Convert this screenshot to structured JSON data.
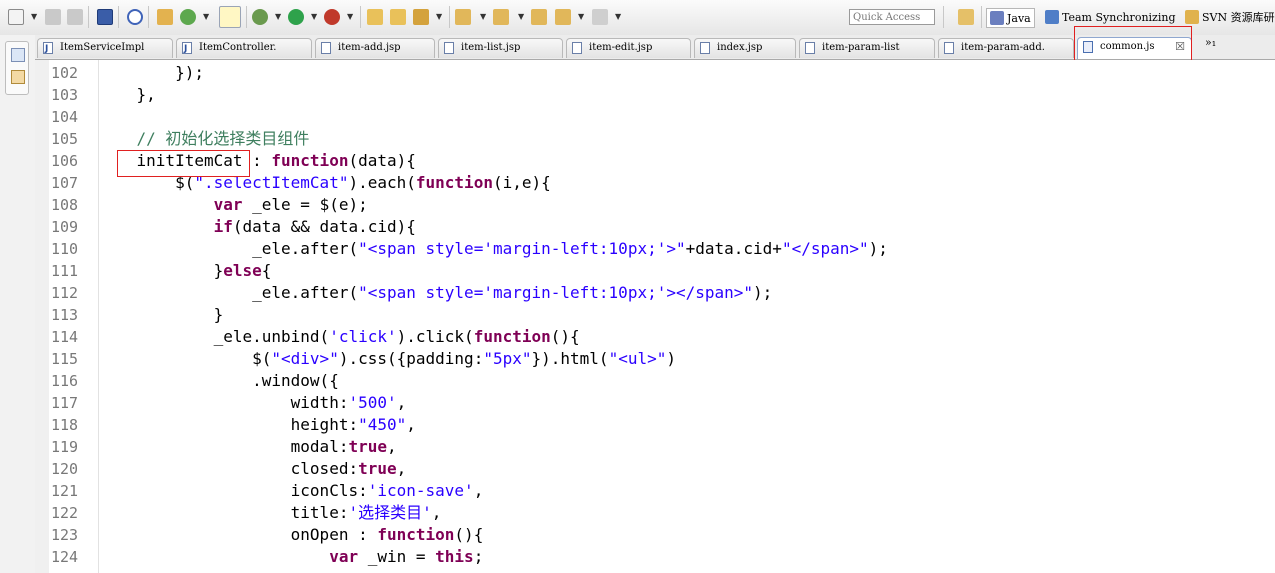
{
  "toolbar": {
    "quick_access_placeholder": "Quick Access",
    "perspectives": [
      {
        "label": "Java",
        "icon": "java-perspective-icon"
      },
      {
        "label": "Team Synchronizing",
        "icon": "team-sync-icon"
      },
      {
        "label": "SVN 资源库研",
        "icon": "svn-icon"
      }
    ]
  },
  "tabs": [
    {
      "label": "ItemServiceImpl",
      "icon": "java-file-icon"
    },
    {
      "label": "ItemController.",
      "icon": "java-file-icon"
    },
    {
      "label": "item-add.jsp",
      "icon": "jsp-file-icon"
    },
    {
      "label": "item-list.jsp",
      "icon": "jsp-file-icon"
    },
    {
      "label": "item-edit.jsp",
      "icon": "jsp-file-icon"
    },
    {
      "label": "index.jsp",
      "icon": "jsp-file-icon"
    },
    {
      "label": "item-param-list",
      "icon": "jsp-file-icon"
    },
    {
      "label": "item-param-add.",
      "icon": "jsp-file-icon"
    },
    {
      "label": "common.js",
      "icon": "js-file-icon",
      "active": true,
      "close": "☒"
    }
  ],
  "tab_overflow": "»₁",
  "line_numbers": [
    "102",
    "103",
    "104",
    "105",
    "106",
    "107",
    "108",
    "109",
    "110",
    "111",
    "112",
    "113",
    "114",
    "115",
    "116",
    "117",
    "118",
    "119",
    "120",
    "121",
    "122",
    "123",
    "124"
  ],
  "code_lines": [
    "        });",
    "    },",
    "",
    "    // 初始化选择类目组件",
    "    initItemCat : function(data){",
    "        $(\".selectItemCat\").each(function(i,e){",
    "            var _ele = $(e);",
    "            if(data && data.cid){",
    "                _ele.after(\"<span style='margin-left:10px;'>\"+data.cid+\"</span>\");",
    "            }else{",
    "                _ele.after(\"<span style='margin-left:10px;'></span>\");",
    "            }",
    "            _ele.unbind('click').click(function(){",
    "                $(\"<div>\").css({padding:\"5px\"}).html(\"<ul>\")",
    "                .window({",
    "                    width:'500',",
    "                    height:\"450\",",
    "                    modal:true,",
    "                    closed:true,",
    "                    iconCls:'icon-save',",
    "                    title:'选择类目',",
    "                    onOpen : function(){",
    "                        var _win = this;"
  ],
  "colors": {
    "keyword": "#7f0055",
    "string": "#2a00ff",
    "comment": "#3f7f5f",
    "highlight_box": "#e02020"
  }
}
